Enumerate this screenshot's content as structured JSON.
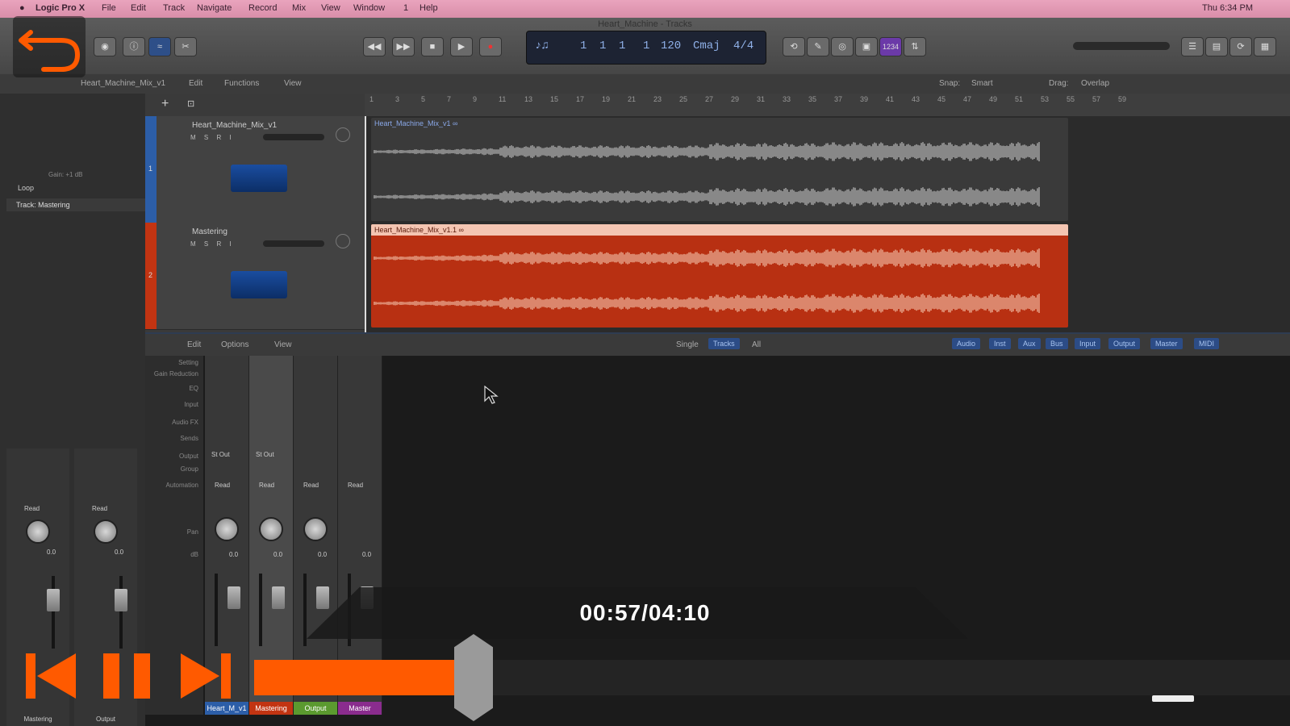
{
  "menubar": {
    "items": [
      "Logic Pro X",
      "File",
      "Edit",
      "Track",
      "Navigate",
      "Record",
      "Mix",
      "View",
      "Window",
      "1",
      "Help"
    ],
    "clock": "Thu 6:34 PM"
  },
  "window": {
    "title": "Heart_Machine - Tracks"
  },
  "toolbar": {
    "transport": [
      "rewind-icon",
      "fast-forward-icon",
      "stop-icon",
      "play-icon",
      "record-icon"
    ],
    "lcd": {
      "bar": "1",
      "beat": "1",
      "division": "1",
      "tick": "1",
      "tempo": "120",
      "key": "Cmaj",
      "sig": "4/4"
    },
    "cpu_label": "1234"
  },
  "subbar": {
    "edit": "Edit",
    "functions": "Functions",
    "view": "View",
    "snap_label": "Snap:",
    "snap_value": "Smart",
    "drag_label": "Drag:",
    "drag_value": "Overlap",
    "region_name": "Heart_Machine_Mix_v1"
  },
  "ruler": {
    "marks": [
      "1",
      "3",
      "5",
      "7",
      "9",
      "11",
      "13",
      "15",
      "17",
      "19",
      "21",
      "23",
      "25",
      "27",
      "29",
      "31",
      "33",
      "35",
      "37",
      "39",
      "41",
      "43",
      "45",
      "47",
      "49",
      "51",
      "53",
      "55",
      "57",
      "59"
    ]
  },
  "inspector": {
    "region_header": "Region: Heart_Machine_Mix_v1",
    "track_label": "Track: Mastering",
    "gain_label": "Gain: +1 dB",
    "loop_label": "Loop",
    "strips": [
      {
        "name": "Mastering",
        "read": "Read",
        "vol": "0.0"
      },
      {
        "name": "Output",
        "read": "Read",
        "vol": "0.0"
      }
    ]
  },
  "tracks": [
    {
      "number": "1",
      "name": "Heart_Machine_Mix_v1",
      "region": "Heart_Machine_Mix_v1 ∞",
      "color": "#2c5ea8",
      "region_bg": "#3a3a3a",
      "wave": "#bdbdbd"
    },
    {
      "number": "2",
      "name": "Mastering",
      "region": "Heart_Machine_Mix_v1.1 ∞",
      "color": "#c23412",
      "region_bg": "#b83012",
      "wave": "#f2c0a8"
    }
  ],
  "mixer": {
    "edit": "Edit",
    "options": "Options",
    "view": "View",
    "scope": [
      "Single",
      "Tracks",
      "All"
    ],
    "filters": [
      "Audio",
      "Inst",
      "Aux",
      "Bus",
      "Input",
      "Output",
      "Master",
      "MIDI"
    ],
    "row_labels": [
      "Setting",
      "Gain Reduction",
      "EQ",
      "Input",
      "Audio FX",
      "Sends",
      "Output",
      "Group",
      "Automation",
      "",
      "Pan",
      "dB"
    ],
    "strips": [
      {
        "name": "Heart_M_v1",
        "color": "#2c5ea8",
        "output": "St Out",
        "read": "Read",
        "vol": "0.0"
      },
      {
        "name": "Mastering",
        "color": "#c23412",
        "output": "St Out",
        "read": "Read",
        "vol": "0.0"
      },
      {
        "name": "Output",
        "color": "#5b9a2f",
        "output": "",
        "read": "Read",
        "vol": "0.0"
      },
      {
        "name": "Master",
        "color": "#8a2c8e",
        "output": "",
        "read": "Read",
        "vol": "0.0"
      }
    ]
  },
  "player": {
    "time": "00:57/04:10",
    "progress": 0.228,
    "accent": "#ff5a00",
    "controls": [
      "skip-back-icon",
      "pause-icon",
      "skip-forward-icon"
    ],
    "back_icon": "undo-arrow-icon"
  }
}
